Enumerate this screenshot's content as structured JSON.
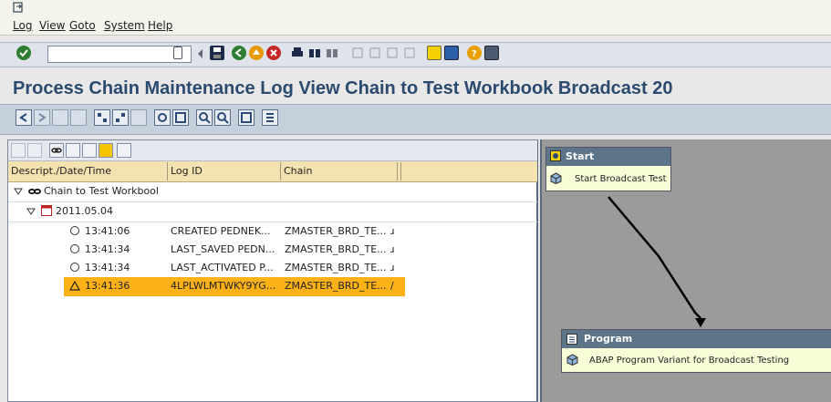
{
  "menubar": {
    "items": [
      "Log",
      "View",
      "Goto",
      "System",
      "Help"
    ]
  },
  "system_toolbar": {
    "command_field_value": ""
  },
  "page_title": "Process Chain Maintenance Log View Chain to Test Workbook Broadcast 20",
  "tree": {
    "columns": [
      "Descript./Date/Time",
      "Log ID",
      "Chain"
    ],
    "root_label": "Chain to Test Workbool",
    "date_node_label": "2011.05.04",
    "rows": [
      {
        "time": "13:41:06",
        "log_id": "CREATED PEDNEK...",
        "chain": "ZMASTER_BRD_TE...",
        "extra": "ɹ"
      },
      {
        "time": "13:41:34",
        "log_id": "LAST_SAVED PEDN...",
        "chain": "ZMASTER_BRD_TE...",
        "extra": "ɹ"
      },
      {
        "time": "13:41:34",
        "log_id": "LAST_ACTIVATED P...",
        "chain": "ZMASTER_BRD_TE...",
        "extra": "ɹ"
      },
      {
        "time": "13:41:36",
        "log_id": "4LPLWLMTWKY9YG...",
        "chain": "ZMASTER_BRD_TE...",
        "extra": "/"
      }
    ],
    "selected_row_color": "#fcb216"
  },
  "graph": {
    "start_node": {
      "header": "Start",
      "label": "Start Broadcast Test"
    },
    "program_node": {
      "header": "Program",
      "label": "ABAP Program Variant for Broadcast Testing"
    }
  },
  "colors": {
    "title": "#2a4a70",
    "node_header": "#5c7588",
    "node_body": "#f8ffd8",
    "column_header": "#f4e2b0"
  }
}
